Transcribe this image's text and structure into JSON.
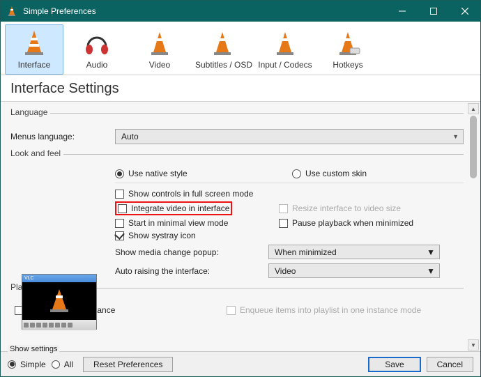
{
  "window": {
    "title": "Simple Preferences"
  },
  "categories": [
    {
      "label": "Interface",
      "selected": true
    },
    {
      "label": "Audio",
      "selected": false
    },
    {
      "label": "Video",
      "selected": false
    },
    {
      "label": "Subtitles / OSD",
      "selected": false
    },
    {
      "label": "Input / Codecs",
      "selected": false
    },
    {
      "label": "Hotkeys",
      "selected": false
    }
  ],
  "page": {
    "title": "Interface Settings"
  },
  "language": {
    "group_label": "Language",
    "menus_label": "Menus language:",
    "value": "Auto"
  },
  "look": {
    "group_label": "Look and feel",
    "native_label": "Use native style",
    "custom_label": "Use custom skin",
    "fullscreen_controls": "Show controls in full screen mode",
    "integrate_video": "Integrate video in interface",
    "resize_to_video": "Resize interface to video size",
    "start_minimal": "Start in minimal view mode",
    "pause_minimized": "Pause playback when minimized",
    "systray": "Show systray icon",
    "media_change_label": "Show media change popup:",
    "media_change_value": "When minimized",
    "auto_raise_label": "Auto raising the interface:",
    "auto_raise_value": "Video"
  },
  "playlist": {
    "group_label": "Playlist and Instances",
    "one_instance": "Allow only one instance",
    "enqueue": "Enqueue items into playlist in one instance mode"
  },
  "bottom": {
    "show_settings": "Show settings",
    "simple": "Simple",
    "all": "All",
    "reset": "Reset Preferences",
    "save": "Save",
    "cancel": "Cancel"
  }
}
